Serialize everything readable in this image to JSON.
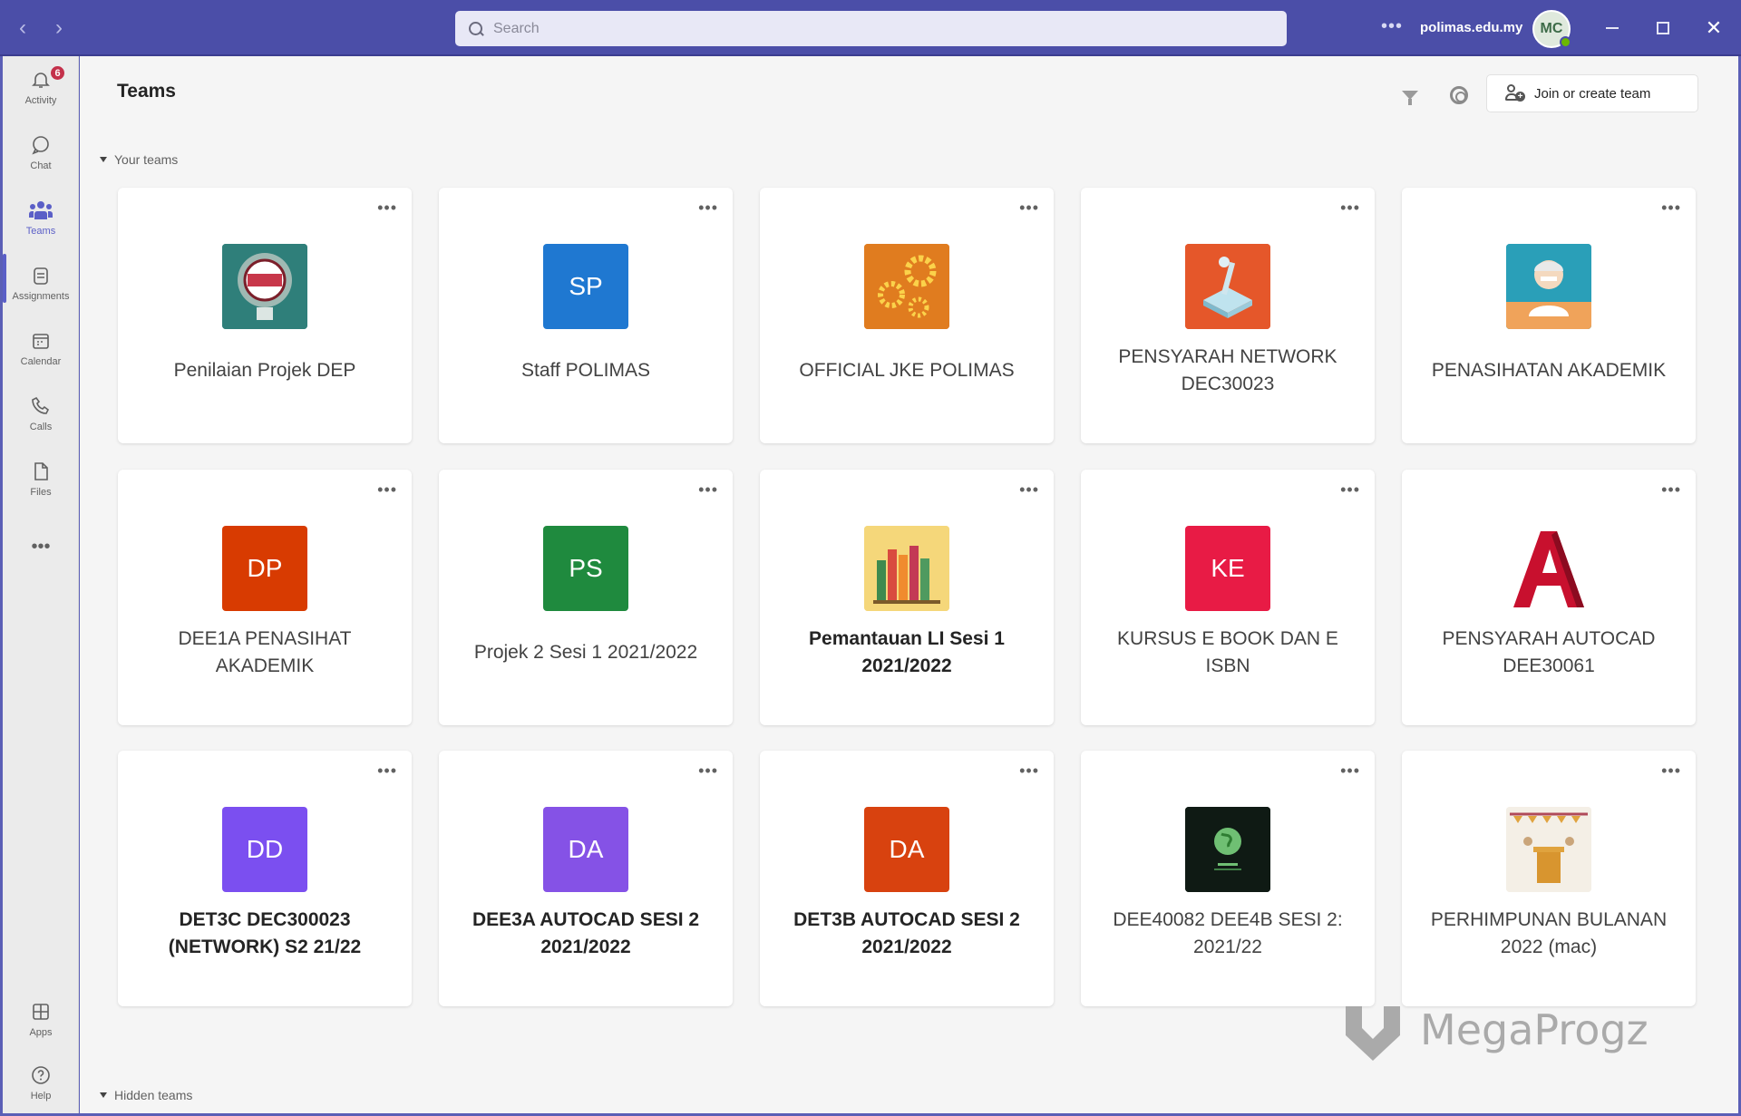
{
  "titlebar": {
    "search_placeholder": "Search",
    "domain": "polimas.edu.my",
    "avatar_initials": "MC"
  },
  "rail": {
    "activity_badge": "6",
    "items": [
      {
        "label": "Activity",
        "icon": "bell-icon"
      },
      {
        "label": "Chat",
        "icon": "chat-icon"
      },
      {
        "label": "Teams",
        "icon": "teams-icon"
      },
      {
        "label": "Assignments",
        "icon": "assignments-icon"
      },
      {
        "label": "Calendar",
        "icon": "calendar-icon"
      },
      {
        "label": "Calls",
        "icon": "phone-icon"
      },
      {
        "label": "Files",
        "icon": "file-icon"
      },
      {
        "label": "Apps",
        "icon": "apps-icon"
      },
      {
        "label": "Help",
        "icon": "help-icon"
      }
    ],
    "more": "•••",
    "accent": "#5b5fc7"
  },
  "main": {
    "title": "Teams",
    "join_button": "Join or create team",
    "your_teams_label": "Your teams",
    "hidden_teams_label": "Hidden teams",
    "card_more": "•••"
  },
  "teams": [
    {
      "name": "Penilaian Projek DEP",
      "initials": "",
      "color": "#2f7f7a",
      "bold": false,
      "image": "target-logo"
    },
    {
      "name": "Staff POLIMAS",
      "initials": "SP",
      "color": "#1f78d1",
      "bold": false
    },
    {
      "name": "OFFICIAL JKE POLIMAS",
      "initials": "",
      "color": "#e07c1f",
      "bold": false,
      "image": "gears-image"
    },
    {
      "name": "PENSYARAH NETWORK DEC30023",
      "initials": "",
      "color": "#e5572a",
      "bold": false,
      "image": "joystick-image"
    },
    {
      "name": "PENASIHATAN AKADEMIK",
      "initials": "",
      "color": "#2a9fb8",
      "bold": false,
      "image": "teacher-image"
    },
    {
      "name": "DEE1A PENASIHAT AKADEMIK",
      "initials": "DP",
      "color": "#d83b01",
      "bold": false
    },
    {
      "name": "Projek 2 Sesi 1 2021/2022",
      "initials": "PS",
      "color": "#1f8a3e",
      "bold": false
    },
    {
      "name": "Pemantauan LI Sesi 1 2021/2022",
      "initials": "",
      "color": "#f5d77a",
      "bold": true,
      "image": "books-image"
    },
    {
      "name": "KURSUS E BOOK DAN E ISBN",
      "initials": "KE",
      "color": "#e81b45",
      "bold": false
    },
    {
      "name": "PENSYARAH AUTOCAD DEE30061",
      "initials": "",
      "color": "#ffffff",
      "bold": false,
      "image": "autocad-logo"
    },
    {
      "name": "DET3C DEC300023 (NETWORK) S2 21/22",
      "initials": "DD",
      "color": "#7b4ff0",
      "bold": true
    },
    {
      "name": "DEE3A AUTOCAD SESI 2 2021/2022",
      "initials": "DA",
      "color": "#8552e6",
      "bold": true
    },
    {
      "name": "DET3B AUTOCAD SESI 2 2021/2022",
      "initials": "DA",
      "color": "#d8420f",
      "bold": true
    },
    {
      "name": "DEE40082 DEE4B SESI 2: 2021/22",
      "initials": "",
      "color": "#0f1a14",
      "bold": false,
      "image": "earth-logo"
    },
    {
      "name": "PERHIMPUNAN BULANAN 2022 (mac)",
      "initials": "",
      "color": "#f4efe6",
      "bold": false,
      "image": "stage-image"
    }
  ],
  "watermark": {
    "text": "MegaProgz"
  }
}
